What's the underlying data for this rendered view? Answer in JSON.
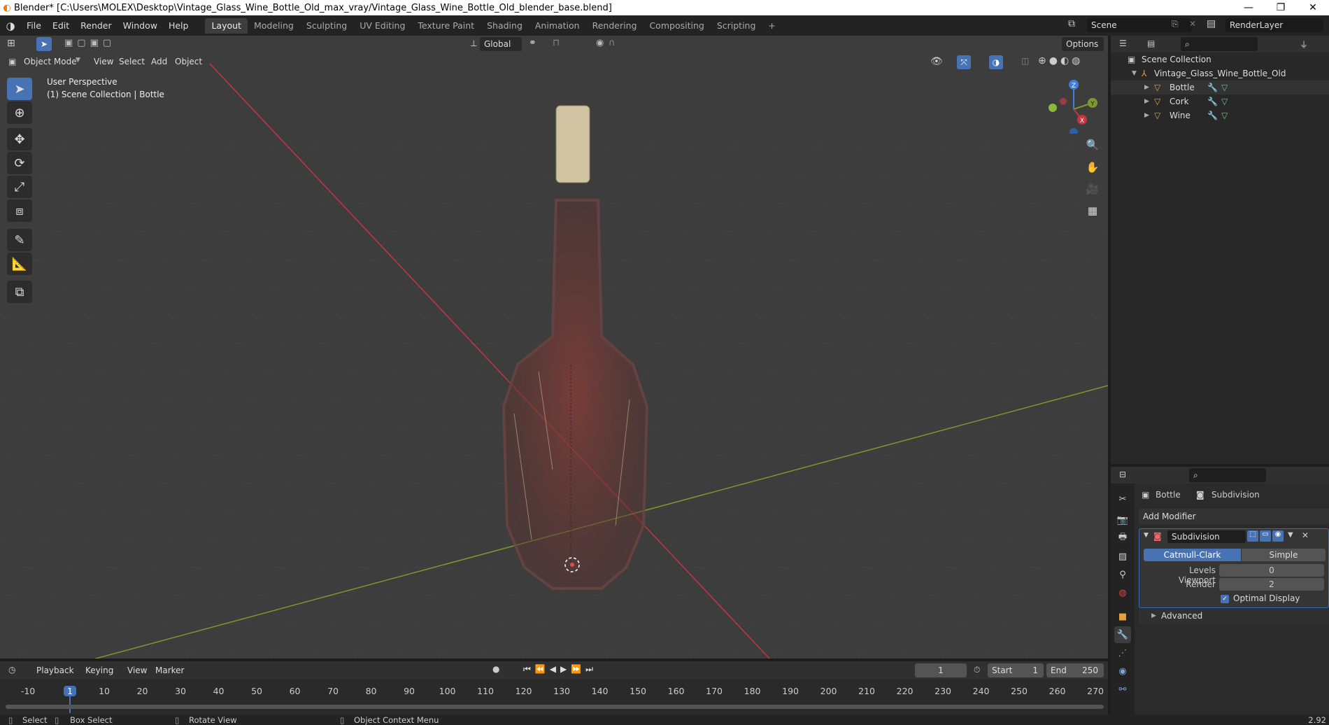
{
  "window": {
    "title": "Blender* [C:\\Users\\MOLEX\\Desktop\\Vintage_Glass_Wine_Bottle_Old_max_vray/Vintage_Glass_Wine_Bottle_Old_blender_base.blend]",
    "minimize": "—",
    "restore": "❐",
    "close": "✕"
  },
  "menubar": {
    "items": [
      "File",
      "Edit",
      "Render",
      "Window",
      "Help"
    ],
    "workspaces": [
      "Layout",
      "Modeling",
      "Sculpting",
      "UV Editing",
      "Texture Paint",
      "Shading",
      "Animation",
      "Rendering",
      "Compositing",
      "Scripting"
    ],
    "active_workspace": "Layout",
    "add_workspace": "+",
    "scene": "Scene",
    "render_layer": "RenderLayer"
  },
  "viewport": {
    "transform_orientation": "Global",
    "options_label": "Options",
    "mode": "Object Mode",
    "menus": [
      "View",
      "Select",
      "Add",
      "Object"
    ],
    "perspective_label": "User Perspective",
    "collection_label": "(1) Scene Collection | Bottle",
    "gizmo_axes": {
      "z": "Z",
      "y": "Y",
      "x": "X"
    },
    "tools": [
      "select-box",
      "cursor",
      "move",
      "rotate",
      "scale",
      "transform",
      "annotate",
      "measure",
      "add-cube"
    ],
    "colors": {
      "x_axis": "#c5363f",
      "y_axis": "#7a9b2c",
      "grid_bg": "#3d3d3d",
      "cork": "#d0c3a2",
      "bottle": "#8a3d38"
    }
  },
  "outliner": {
    "root": "Scene Collection",
    "collection": "Vintage_Glass_Wine_Bottle_Old",
    "objects": [
      "Bottle",
      "Cork",
      "Wine"
    ]
  },
  "properties": {
    "object_name": "Bottle",
    "modifier_tab": "Subdivision",
    "add_modifier": "Add Modifier",
    "modifier": {
      "name": "Subdivision",
      "modes": [
        "Catmull-Clark",
        "Simple"
      ],
      "active_mode": "Catmull-Clark",
      "levels_viewport_label": "Levels Viewport",
      "levels_viewport": "0",
      "render_label": "Render",
      "render": "2",
      "optimal_display_label": "Optimal Display",
      "optimal_display": true,
      "advanced_label": "Advanced"
    }
  },
  "timeline": {
    "menus": [
      "Playback",
      "Keying",
      "View",
      "Marker"
    ],
    "current_frame": "1",
    "start_label": "Start",
    "start": "1",
    "end_label": "End",
    "end": "250",
    "ruler": [
      "-10",
      "1",
      "10",
      "20",
      "30",
      "40",
      "50",
      "60",
      "70",
      "80",
      "90",
      "100",
      "110",
      "120",
      "130",
      "140",
      "150",
      "160",
      "170",
      "180",
      "190",
      "200",
      "210",
      "220",
      "230",
      "240",
      "250",
      "260",
      "270"
    ]
  },
  "statusbar": {
    "select": "Select",
    "box_select": "Box Select",
    "rotate_view": "Rotate View",
    "context_menu": "Object Context Menu",
    "version": "2.92"
  }
}
